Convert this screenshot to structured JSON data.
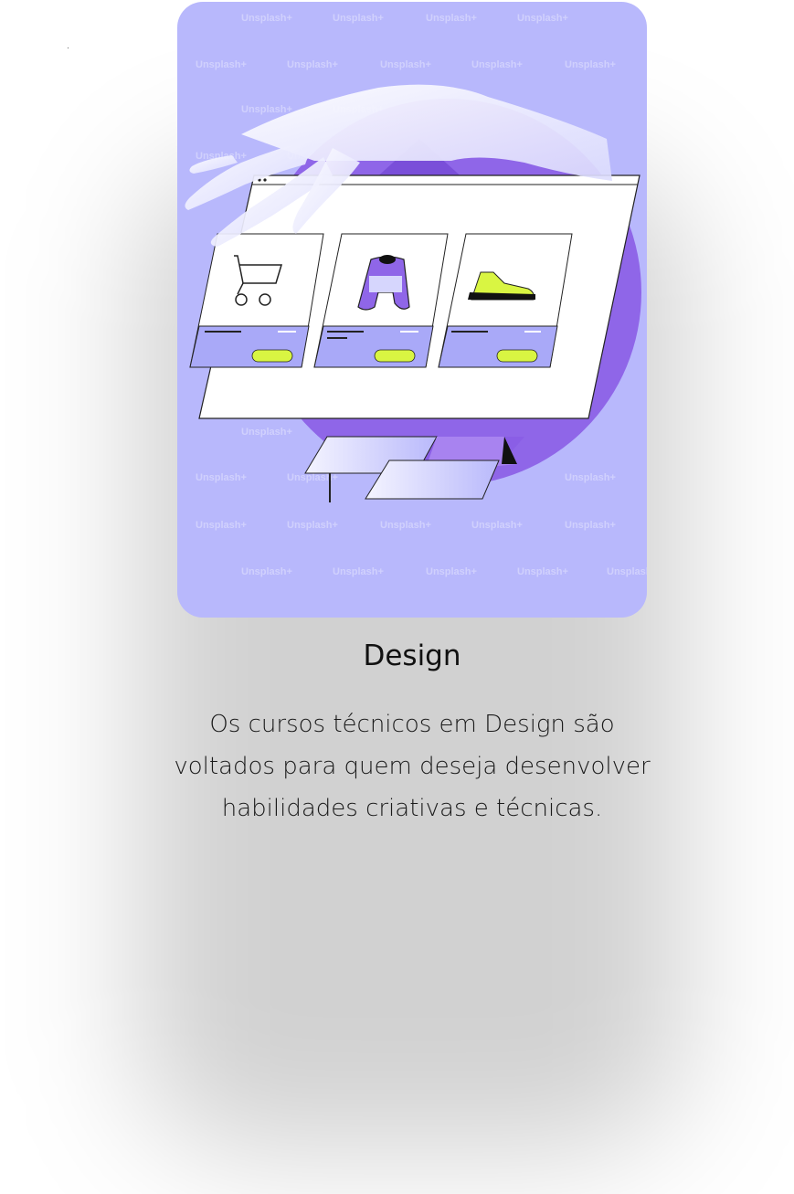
{
  "card": {
    "title": "Design",
    "description": "Os cursos técnicos em Design são voltados para quem deseja desenvolver habilidades criativas e técnicas.",
    "watermark": "Unsplash+",
    "colors": {
      "card_background": "#b8b8fc",
      "purple_circle": "#8f66e8",
      "accent_lime": "#d9f542",
      "product_panel": "#a9a9f8"
    },
    "illustration": {
      "subject": "hand-placing-storefront-window",
      "products": [
        "shopping-cart-icon",
        "sweater-icon",
        "sneaker-icon"
      ]
    }
  }
}
